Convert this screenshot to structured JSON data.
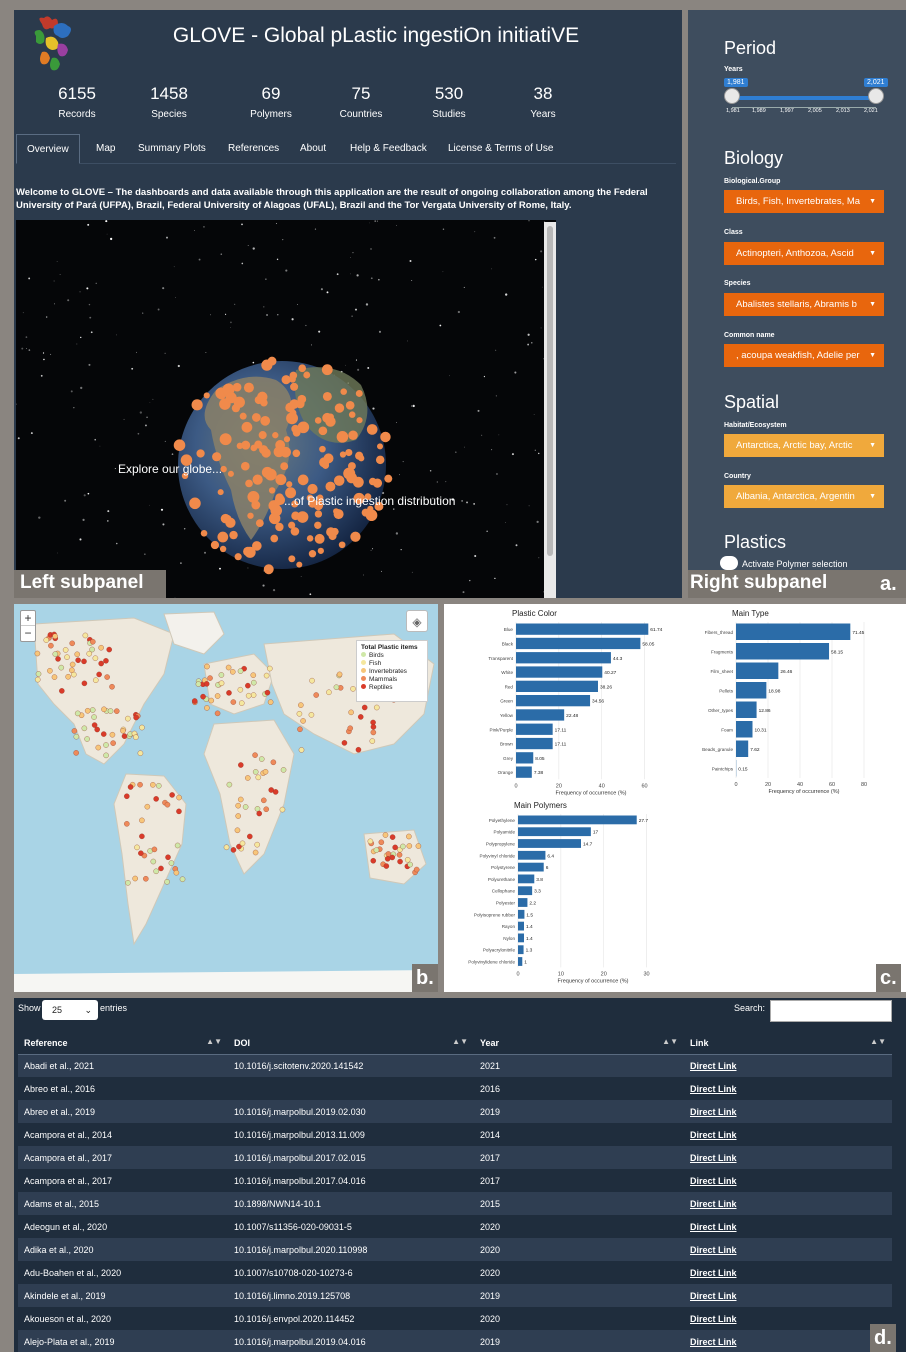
{
  "app": {
    "title": "GLOVE - Global pLastic ingestiOn initiatiVE"
  },
  "stats": [
    {
      "value": "6155",
      "label": "Records"
    },
    {
      "value": "1458",
      "label": "Species"
    },
    {
      "value": "69",
      "label": "Polymers"
    },
    {
      "value": "75",
      "label": "Countries"
    },
    {
      "value": "530",
      "label": "Studies"
    },
    {
      "value": "38",
      "label": "Years"
    }
  ],
  "tabs": [
    "Overview",
    "Map",
    "Summary Plots",
    "References",
    "About",
    "Help & Feedback",
    "License & Terms of Use"
  ],
  "welcome": "Welcome to GLOVE – The dashboards and data available through this application are the result of ongoing collaboration among the Federal University of Pará (UFPA), Brazil, Federal University of Alagoas (UFAL), Brazil and the Tor Vergata University of Rome, Italy.",
  "globe": {
    "text1": "Explore our globe...",
    "text2": "...of Plastic ingestion distribution"
  },
  "panel_labels": {
    "left": "Left subpanel",
    "right": "Right subpanel",
    "a": "a.",
    "b": "b.",
    "c": "c.",
    "d": "d."
  },
  "sidebar": {
    "period": {
      "heading": "Period",
      "years_label": "Years",
      "min": "1,981",
      "max": "2,021",
      "tick_labels": [
        "1,981",
        "1,989",
        "1,997",
        "2,005",
        "2,013",
        "2,021"
      ],
      "range_from": 1981,
      "range_to": 2021
    },
    "biology": {
      "heading": "Biology",
      "fields": [
        {
          "label": "Biological.Group",
          "value": "Birds, Fish, Invertebrates, Ma"
        },
        {
          "label": "Class",
          "value": "Actinopteri, Anthozoa, Ascid"
        },
        {
          "label": "Species",
          "value": "Abalistes stellaris, Abramis b"
        },
        {
          "label": "Common name",
          "value": ", acoupa weakfish, Adelie per"
        }
      ]
    },
    "spatial": {
      "heading": "Spatial",
      "fields": [
        {
          "label": "Habitat/Ecosystem",
          "value": "Antarctica, Arctic bay, Arctic"
        },
        {
          "label": "Country",
          "value": "Albania, Antarctica, Argentin"
        }
      ]
    },
    "plastics": {
      "heading": "Plastics",
      "toggle_label": "Activate Polymer selection"
    },
    "colors": {
      "dark_select": "#e8660d",
      "light_select": "#f0a93c",
      "slider": "#2f7ed2"
    }
  },
  "map": {
    "zoom_in": "+",
    "zoom_out": "−",
    "legend_title": "Total Plastic items",
    "legend": [
      {
        "name": "Birds",
        "color": "#cfe8a8"
      },
      {
        "name": "Fish",
        "color": "#f5e79e"
      },
      {
        "name": "Invertebrates",
        "color": "#f7c67a"
      },
      {
        "name": "Mammals",
        "color": "#ee8a5a"
      },
      {
        "name": "Reptiles",
        "color": "#d93b2a"
      }
    ]
  },
  "chart_data": [
    {
      "type": "bar",
      "title": "Plastic Color",
      "xlabel": "Frequency of occurrence (%)",
      "categories": [
        "Blue",
        "Black",
        "Transparent",
        "White",
        "Red",
        "Green",
        "Yellow",
        "Pink/Purple",
        "Brown",
        "Grey",
        "Orange"
      ],
      "values": [
        61.74,
        58.05,
        44.3,
        40.27,
        38.26,
        34.56,
        22.48,
        17.11,
        17.11,
        8.05,
        7.38
      ],
      "xticks": [
        "0",
        "20",
        "40",
        "60"
      ],
      "xlim": [
        0,
        70
      ]
    },
    {
      "type": "bar",
      "title": "Main Type",
      "xlabel": "Frequency of occurrence (%)",
      "categories": [
        "Fibers_thread",
        "Fragments",
        "Film_sheet",
        "Pellets",
        "Other_types",
        "Foam",
        "Beads_granule",
        "Paintchips"
      ],
      "values": [
        71.45,
        58.15,
        26.46,
        18.98,
        12.86,
        10.31,
        7.62,
        0.15
      ],
      "xticks": [
        "0",
        "20",
        "40",
        "60",
        "80"
      ],
      "xlim": [
        0,
        85
      ]
    },
    {
      "type": "bar",
      "title": "Main Polymers",
      "xlabel": "Frequency of occurrence (%)",
      "categories": [
        "Polyethylene",
        "Polyamide",
        "Polypropylene",
        "Polyvinyl chloride",
        "Polystyrene",
        "Polyurethane",
        "Cellophane",
        "Polyester",
        "Polyisoprene rubber",
        "Rayon",
        "Nylon",
        "Polyacrylonitrile",
        "Polyvinylidene chloride"
      ],
      "values": [
        27.7,
        17,
        14.7,
        6.4,
        6,
        3.8,
        3.3,
        2.2,
        1.5,
        1.4,
        1.4,
        1.3,
        1
      ],
      "xticks": [
        "0",
        "10",
        "20",
        "30"
      ],
      "xlim": [
        0,
        35
      ]
    }
  ],
  "table": {
    "show": "Show",
    "page_size": "25",
    "entries": "entries",
    "search_label": "Search:",
    "columns": [
      "Reference",
      "DOI",
      "Year",
      "Link"
    ],
    "rows": [
      [
        "Abadi et al., 2021",
        "10.1016/j.scitotenv.2020.141542",
        "2021",
        "Direct Link"
      ],
      [
        "Abreo et al., 2016",
        "",
        "2016",
        "Direct Link"
      ],
      [
        "Abreo et al., 2019",
        "10.1016/j.marpolbul.2019.02.030",
        "2019",
        "Direct Link"
      ],
      [
        "Acampora et al., 2014",
        "10.1016/j.marpolbul.2013.11.009",
        "2014",
        "Direct Link"
      ],
      [
        "Acampora et al., 2017",
        "10.1016/j.marpolbul.2017.02.015",
        "2017",
        "Direct Link"
      ],
      [
        "Acampora et al., 2017",
        "10.1016/j.marpolbul.2017.04.016",
        "2017",
        "Direct Link"
      ],
      [
        "Adams et al., 2015",
        "10.1898/NWN14-10.1",
        "2015",
        "Direct Link"
      ],
      [
        "Adeogun et al., 2020",
        "10.1007/s11356-020-09031-5",
        "2020",
        "Direct Link"
      ],
      [
        "Adika et al., 2020",
        "10.1016/j.marpolbul.2020.110998",
        "2020",
        "Direct Link"
      ],
      [
        "Adu-Boahen et al., 2020",
        "10.1007/s10708-020-10273-6",
        "2020",
        "Direct Link"
      ],
      [
        "Akindele et al., 2019",
        "10.1016/j.limno.2019.125708",
        "2019",
        "Direct Link"
      ],
      [
        "Akoueson et al., 2020",
        "10.1016/j.envpol.2020.114452",
        "2020",
        "Direct Link"
      ],
      [
        "Alejo-Plata et al., 2019",
        "10.1016/j.marpolbul.2019.04.016",
        "2019",
        "Direct Link"
      ]
    ]
  },
  "accent_colors": {
    "bar": "#2b6ca8",
    "panel_bg": "#2b3a4c",
    "dots": "#f08a4b"
  }
}
